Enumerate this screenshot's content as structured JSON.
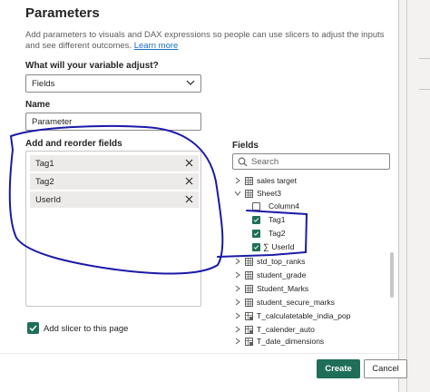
{
  "dialog": {
    "title": "Parameters",
    "description": "Add parameters to visuals and DAX expressions so people can use slicers to adjust the inputs and see different outcomes.",
    "learn_more": "Learn more"
  },
  "variable": {
    "label": "What will your variable adjust?",
    "selected": "Fields"
  },
  "name": {
    "label": "Name",
    "value": "Parameter"
  },
  "add_reorder": {
    "label": "Add and reorder fields",
    "items": [
      "Tag1",
      "Tag2",
      "UserId"
    ]
  },
  "fields_pane": {
    "label": "Fields",
    "search_placeholder": "Search",
    "tree": [
      {
        "label": "sales target",
        "type": "table",
        "expanded": false
      },
      {
        "label": "Sheet3",
        "type": "table",
        "expanded": true
      },
      {
        "label": "Column4",
        "type": "column",
        "checked": false
      },
      {
        "label": "Tag1",
        "type": "column",
        "checked": true
      },
      {
        "label": "Tag2",
        "type": "column",
        "checked": true
      },
      {
        "label": "UserId",
        "type": "measure-column",
        "checked": true
      },
      {
        "label": "std_top_ranks",
        "type": "table",
        "expanded": false
      },
      {
        "label": "student_grade",
        "type": "table",
        "expanded": false
      },
      {
        "label": "Student_Marks",
        "type": "table",
        "expanded": false
      },
      {
        "label": "student_secure_marks",
        "type": "table",
        "expanded": false
      },
      {
        "label": "T_calculatetable_india_pop",
        "type": "calc-table",
        "expanded": false
      },
      {
        "label": "T_calender_auto",
        "type": "calc-table",
        "expanded": false
      },
      {
        "label": "T_date_dimensions",
        "type": "calc-table",
        "expanded": false
      }
    ]
  },
  "slicer": {
    "label": "Add slicer to this page",
    "checked": true
  },
  "buttons": {
    "create": "Create",
    "cancel": "Cancel"
  },
  "colors": {
    "accent": "#1f6e5a",
    "annotation": "#1a1aa8",
    "link": "#1a6fc2"
  }
}
